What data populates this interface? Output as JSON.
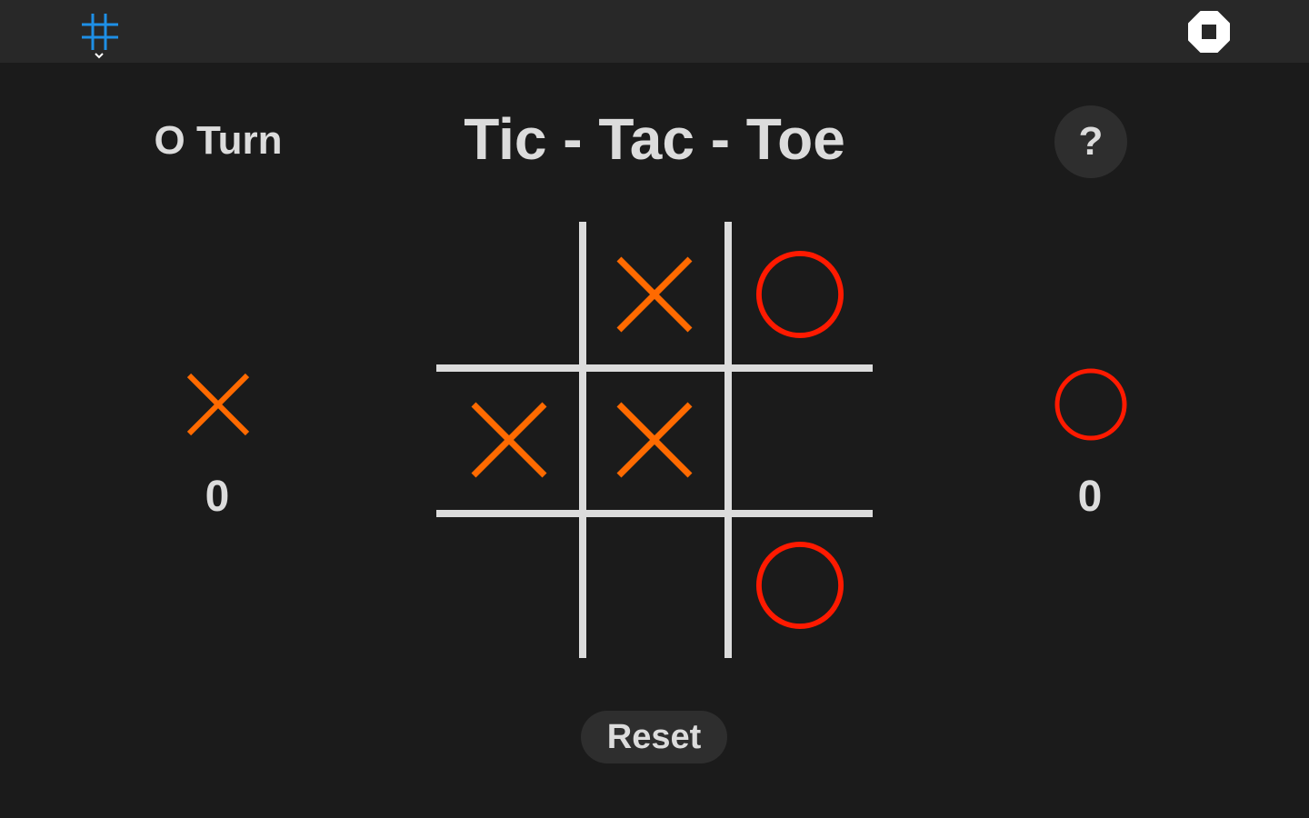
{
  "topbar": {
    "app_icon": "hash-grid-icon",
    "app_icon_color": "#1e8fe6",
    "stop_icon": "stop-octagon-icon"
  },
  "game": {
    "turn_label": "O Turn",
    "title": "Tic - Tac - Toe",
    "help_label": "?",
    "reset_label": "Reset"
  },
  "scores": {
    "x": {
      "mark": "X",
      "value": "0"
    },
    "o": {
      "mark": "O",
      "value": "0"
    }
  },
  "board": {
    "cells": [
      "",
      "X",
      "O",
      "X",
      "X",
      "",
      "",
      "",
      "O"
    ]
  },
  "colors": {
    "x": "#ff6a00",
    "o": "#ff1a00",
    "grid": "#dcdcdc",
    "text": "#dcdcdc",
    "background": "#1b1b1b",
    "topbar": "#282828"
  }
}
